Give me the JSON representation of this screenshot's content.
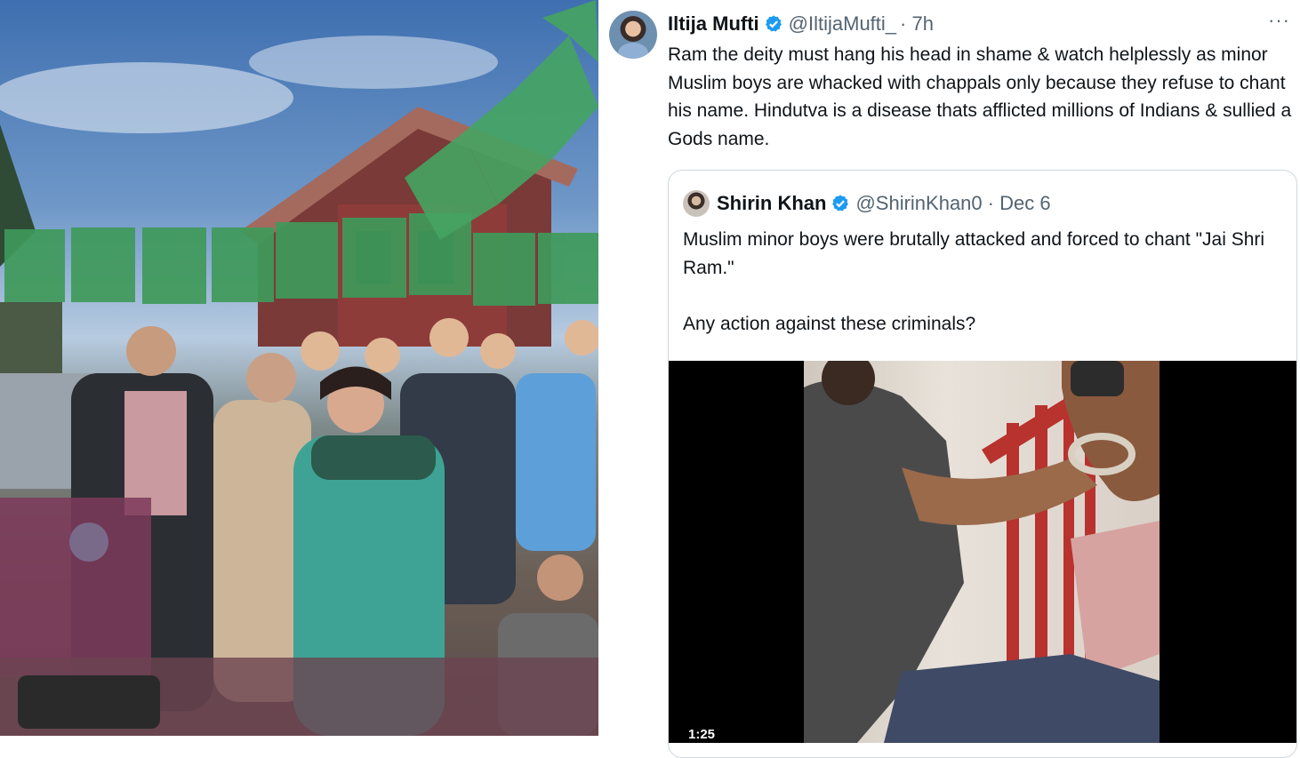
{
  "tweet": {
    "author_name": "Iltija Mufti",
    "author_handle": "@IltijaMufti_",
    "time": "· 7h",
    "body": "Ram the deity must hang his head in shame & watch helplessly as minor Muslim boys are whacked with chappals only because they refuse to chant his name. Hindutva is a disease thats afflicted millions of Indians & sullied a Gods name.",
    "more_icon": "more-icon"
  },
  "quote": {
    "author_name": "Shirin Khan",
    "author_handle": "@ShirinKhan0",
    "time": "· Dec 6",
    "line1": "Muslim minor boys were brutally attacked and forced to chant \"Jai Shri Ram.\"",
    "line2": "Any action against these criminals?",
    "video_duration": "1:25"
  },
  "colors": {
    "verified_blue": "#1d9bf0",
    "text_primary": "#0f1419",
    "text_muted": "#536471",
    "border": "#cfd9de",
    "flag_green": "#3f9a5a"
  }
}
